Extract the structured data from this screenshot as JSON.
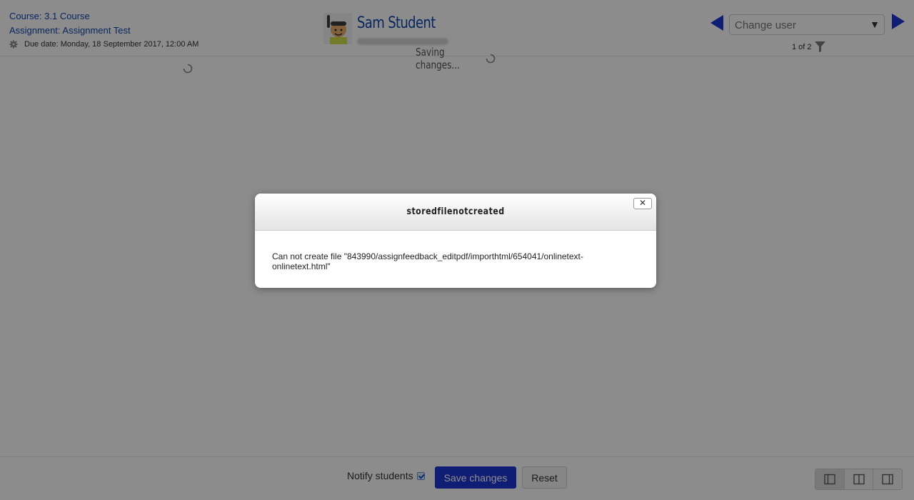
{
  "header": {
    "course_link": "Course: 3.1 Course",
    "assignment_link": "Assignment: Assignment Test",
    "due_date": "Due date: Monday, 18 September 2017, 12:00 AM",
    "student_name": "Sam Student",
    "saving_text": "Saving changes...",
    "change_user_placeholder": "Change user",
    "user_count": "1 of 2"
  },
  "footer": {
    "notify_label": "Notify students",
    "notify_checked": true,
    "save_label": "Save changes",
    "reset_label": "Reset"
  },
  "dialog": {
    "title": "storedfilenotcreated",
    "close_glyph": "✕",
    "message": "Can not create file \"843990/assignfeedback_editpdf/importhtml/654041/onlinetext-onlinetext.html\""
  },
  "colors": {
    "link": "#0f47ad",
    "primary_button": "#1e35d4",
    "nav_arrow": "#1e35d4"
  },
  "icons": [
    "gear-icon",
    "spinner-icon",
    "chevron-down-icon",
    "filter-icon",
    "prev-arrow-icon",
    "next-arrow-icon",
    "close-icon",
    "layout-left-icon",
    "layout-both-icon",
    "layout-right-icon"
  ]
}
